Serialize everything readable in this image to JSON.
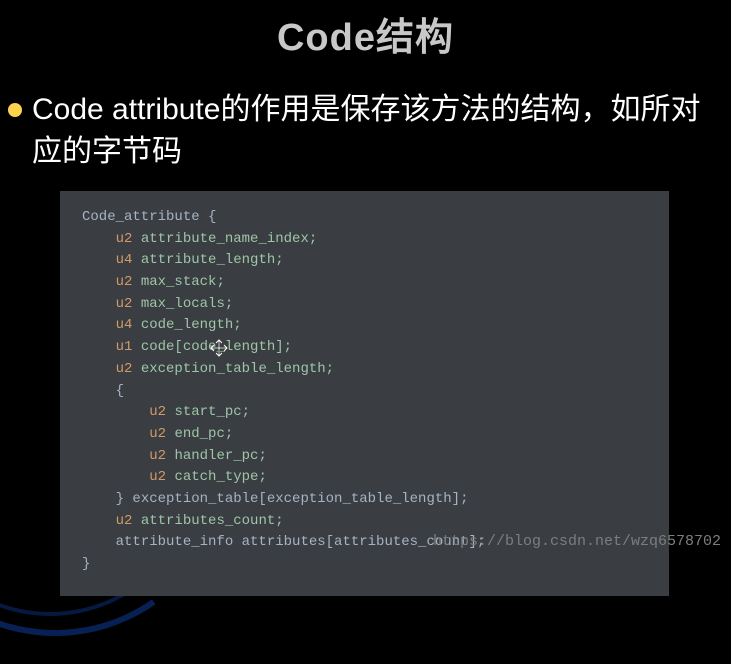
{
  "title": "Code结构",
  "bullet_text": "Code attribute的作用是保存该方法的结构，如所对应的字节码",
  "code": {
    "l0": "Code_attribute {",
    "l1_t": "u2",
    "l1_n": "attribute_name_index;",
    "l2_t": "u4",
    "l2_n": "attribute_length;",
    "l3_t": "u2",
    "l3_n": "max_stack;",
    "l4_t": "u2",
    "l4_n": "max_locals;",
    "l5_t": "u4",
    "l5_n": "code_length;",
    "l6_t": "u1",
    "l6_n": "code[code_length];",
    "l7_t": "u2",
    "l7_n": "exception_table_length;",
    "l8": "{",
    "l9_t": "u2",
    "l9_n": "start_pc;",
    "l10_t": "u2",
    "l10_n": "end_pc;",
    "l11_t": "u2",
    "l11_n": "handler_pc;",
    "l12_t": "u2",
    "l12_n": "catch_type;",
    "l13": "} exception_table[exception_table_length];",
    "l14_t": "u2",
    "l14_n": "attributes_count;",
    "l15": "attribute_info attributes[attributes_count];",
    "l16": "}"
  },
  "watermark": "https://blog.csdn.net/wzq6578702"
}
